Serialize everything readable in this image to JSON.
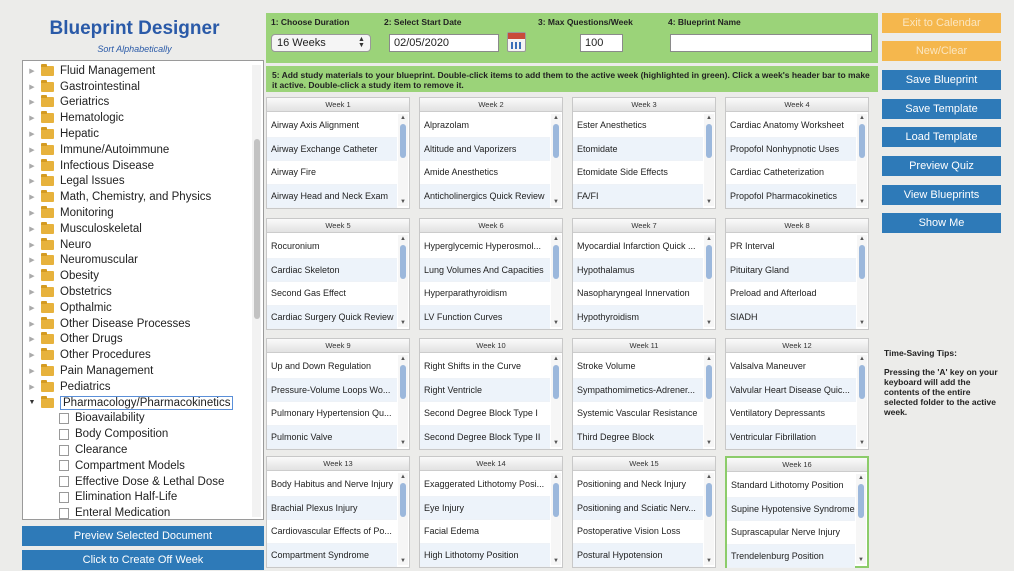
{
  "app": {
    "title": "Blueprint Designer",
    "sort_link": "Sort Alphabetically"
  },
  "tree": {
    "folders": [
      {
        "label": "Fluid Management"
      },
      {
        "label": "Gastrointestinal"
      },
      {
        "label": "Geriatrics"
      },
      {
        "label": "Hematologic"
      },
      {
        "label": "Hepatic"
      },
      {
        "label": "Immune/Autoimmune"
      },
      {
        "label": "Infectious Disease"
      },
      {
        "label": "Legal Issues"
      },
      {
        "label": "Math, Chemistry, and Physics"
      },
      {
        "label": "Monitoring"
      },
      {
        "label": "Musculoskeletal"
      },
      {
        "label": "Neuro"
      },
      {
        "label": "Neuromuscular"
      },
      {
        "label": "Obesity"
      },
      {
        "label": "Obstetrics"
      },
      {
        "label": "Opthalmic"
      },
      {
        "label": "Other Disease Processes"
      },
      {
        "label": "Other Drugs"
      },
      {
        "label": "Other Procedures"
      },
      {
        "label": "Pain Management"
      },
      {
        "label": "Pediatrics"
      }
    ],
    "open_folder": {
      "label": "Pharmacology/Pharmacokinetics"
    },
    "children": [
      {
        "label": "Bioavailability"
      },
      {
        "label": "Body Composition"
      },
      {
        "label": "Clearance"
      },
      {
        "label": "Compartment Models"
      },
      {
        "label": "Effective Dose & Lethal Dose"
      },
      {
        "label": "Elimination Half-Life"
      },
      {
        "label": "Enteral Medication"
      }
    ]
  },
  "bottom_buttons": {
    "preview_document": "Preview Selected Document",
    "create_off_week": "Click to Create Off Week"
  },
  "controls": {
    "duration_label": "1: Choose Duration",
    "duration_value": "16 Weeks",
    "start_date_label": "2: Select Start Date",
    "start_date_value": "02/05/2020",
    "max_questions_label": "3: Max Questions/Week",
    "max_questions_value": "100",
    "blueprint_name_label": "4: Blueprint Name",
    "blueprint_name_value": ""
  },
  "instructions": "5: Add study materials to your blueprint. Double-click items to add them to the active week (highlighted in green). Click a week's header bar to make it active. Double-click a study item to remove it.",
  "weeks": [
    {
      "label": "Week 1",
      "items": [
        "Airway Axis Alignment",
        "Airway Exchange Catheter",
        "Airway Fire",
        "Airway Head and Neck Exam"
      ]
    },
    {
      "label": "Week 2",
      "items": [
        "Alprazolam",
        "Altitude and Vaporizers",
        "Amide Anesthetics",
        "Anticholinergics Quick Review"
      ]
    },
    {
      "label": "Week 3",
      "items": [
        "Ester Anesthetics",
        "Etomidate",
        "Etomidate Side Effects",
        "FA/FI"
      ]
    },
    {
      "label": "Week 4",
      "items": [
        "Cardiac Anatomy Worksheet",
        "Propofol Nonhypnotic Uses",
        "Cardiac Catheterization",
        "Propofol Pharmacokinetics"
      ]
    },
    {
      "label": "Week 5",
      "items": [
        "Rocuronium",
        "Cardiac Skeleton",
        "Second Gas Effect",
        "Cardiac Surgery Quick Review"
      ]
    },
    {
      "label": "Week 6",
      "items": [
        "Hyperglycemic Hyperosmol...",
        "Lung Volumes And Capacities",
        "Hyperparathyroidism",
        "LV Function Curves"
      ]
    },
    {
      "label": "Week 7",
      "items": [
        "Myocardial Infarction Quick ...",
        "Hypothalamus",
        "Nasopharyngeal Innervation",
        "Hypothyroidism"
      ]
    },
    {
      "label": "Week 8",
      "items": [
        "PR Interval",
        "Pituitary Gland",
        "Preload and Afterload",
        "SIADH"
      ]
    },
    {
      "label": "Week 9",
      "items": [
        "Up and Down Regulation",
        "Pressure-Volume Loops Wo...",
        "Pulmonary Hypertension Qu...",
        "Pulmonic Valve"
      ]
    },
    {
      "label": "Week 10",
      "items": [
        "Right Shifts in the Curve",
        "Right Ventricle",
        "Second Degree Block Type I",
        "Second Degree Block Type II"
      ]
    },
    {
      "label": "Week 11",
      "items": [
        "Stroke Volume",
        "Sympathomimetics-Adrener...",
        "Systemic Vascular Resistance",
        "Third Degree Block"
      ]
    },
    {
      "label": "Week 12",
      "items": [
        "Valsalva Maneuver",
        "Valvular Heart Disease Quic...",
        "Ventilatory Depressants",
        "Ventricular Fibrillation"
      ]
    },
    {
      "label": "Week 13",
      "items": [
        "Body Habitus and Nerve Injury",
        "Brachial Plexus Injury",
        "Cardiovascular Effects of Po...",
        "Compartment Syndrome"
      ]
    },
    {
      "label": "Week 14",
      "items": [
        "Exaggerated Lithotomy Posi...",
        "Eye Injury",
        "Facial Edema",
        "High Lithotomy Position"
      ]
    },
    {
      "label": "Week 15",
      "items": [
        "Positioning and Neck Injury",
        "Positioning and Sciatic Nerv...",
        "Postoperative Vision Loss",
        "Postural Hypotension"
      ]
    },
    {
      "label": "Week 16",
      "items": [
        "Standard Lithotomy Position",
        "Supine Hypotensive Syndrome",
        "Suprascapular Nerve Injury",
        "Trendelenburg Position"
      ]
    }
  ],
  "active_week": 16,
  "side_buttons": {
    "exit_calendar": "Exit to Calendar",
    "new_clear": "New/Clear",
    "save_blueprint": "Save Blueprint",
    "save_template": "Save Template",
    "load_template": "Load Template",
    "preview_quiz": "Preview Quiz",
    "view_blueprints": "View Blueprints",
    "show_me": "Show Me"
  },
  "tips": {
    "title": "Time-Saving Tips:",
    "body": "Pressing the 'A' key on your keyboard will add the contents of the entire selected folder to the active week."
  },
  "colors": {
    "accent_blue": "#2e7ab8",
    "title_blue": "#2a5aa8",
    "control_green": "#9bd379",
    "active_week_border": "#8ccc6a",
    "orange_button": "#f5b74d"
  }
}
